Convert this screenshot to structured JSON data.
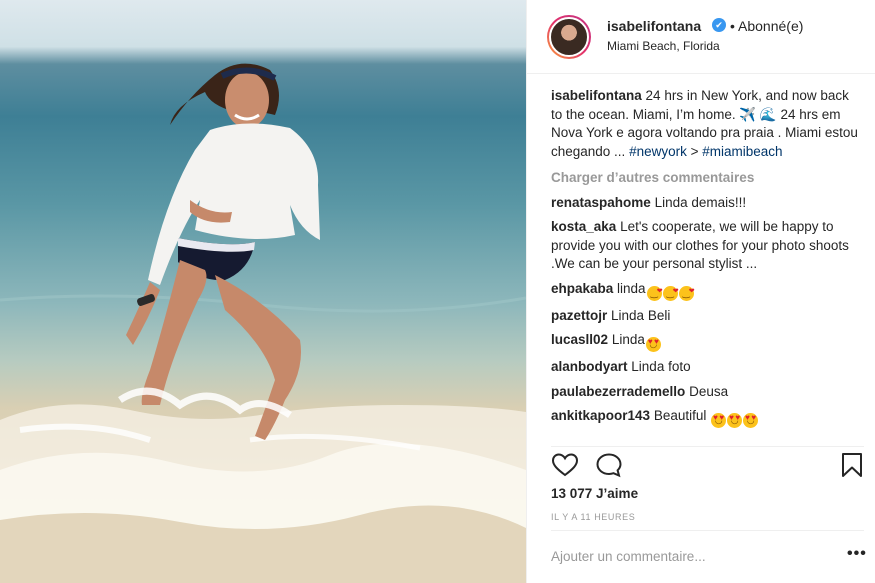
{
  "post": {
    "username": "isabelifontana",
    "verified_mark": "✔",
    "follow_status": "• Abonné(e)",
    "location": "Miami Beach, Florida"
  },
  "caption": {
    "username": "isabelifontana",
    "text": "24 hrs in New York, and now back to the ocean. Miami, I’m home. ✈️ 🌊 24 hrs em Nova York e agora voltando pra praia . Miami estou chegando ... ",
    "hashtag1": "#newyork",
    "between": " > ",
    "hashtag2": "#miamibeach"
  },
  "load_more": "Charger d’autres commentaires",
  "comments": [
    {
      "user": "renataspahome",
      "text": "Linda demais!!!"
    },
    {
      "user": "kosta_aka",
      "text": "Let's cooperate, we will be happy to provide you with our clothes for your photo shoots .We can be your personal stylist ..."
    },
    {
      "user": "ehpakaba",
      "text": "linda"
    },
    {
      "user": "pazettojr",
      "text": "Linda Beli"
    },
    {
      "user": "lucasll02",
      "text": "Linda"
    },
    {
      "user": "alanbodyart",
      "text": "Linda foto"
    },
    {
      "user": "paulabezerrademello",
      "text": "Deusa"
    },
    {
      "user": "ankitkapoor143",
      "text": "Beautiful"
    }
  ],
  "likes": "13 077 J’aime",
  "timestamp": "IL Y A 11 HEURES",
  "add_comment_placeholder": "Ajouter un commentaire...",
  "more_options": "•••",
  "icons": {
    "like": "heart-outline-icon",
    "comment": "speech-bubble-icon",
    "save": "bookmark-icon",
    "verified": "verified-badge-icon"
  },
  "colors": {
    "text": "#262626",
    "muted": "#999999",
    "hashtag": "#003569",
    "verified": "#3897f0"
  }
}
